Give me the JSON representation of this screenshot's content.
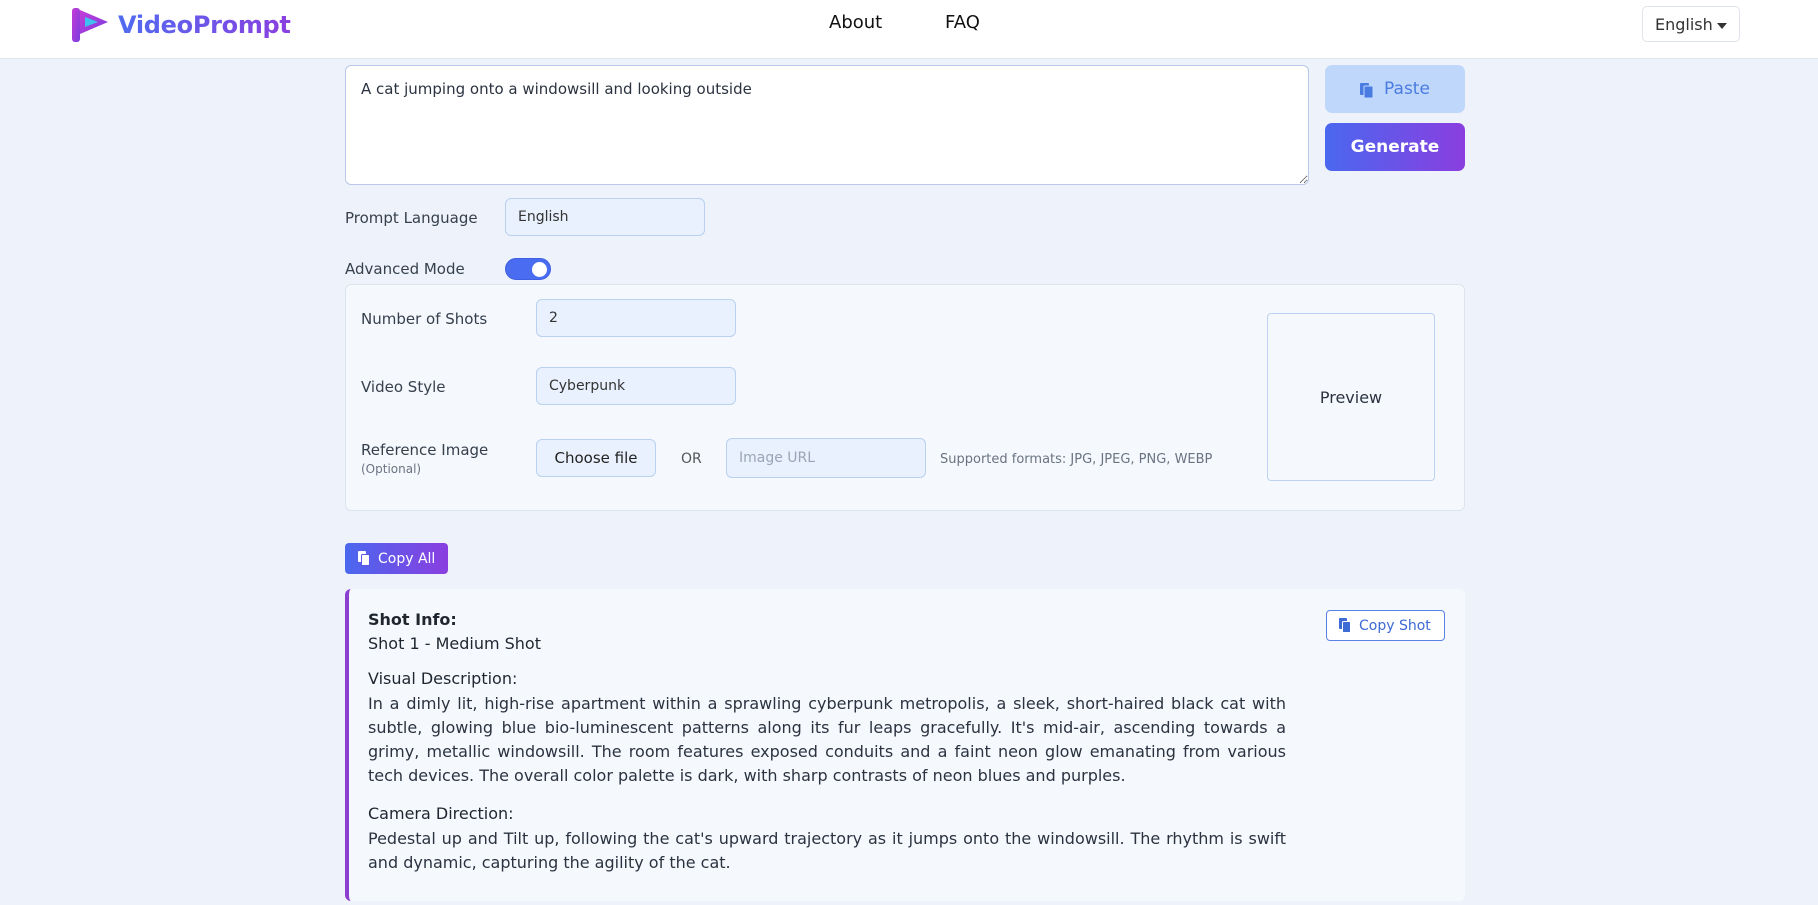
{
  "header": {
    "logo_text": "VideoPrompt",
    "nav": [
      {
        "label": "About"
      },
      {
        "label": "FAQ"
      }
    ],
    "language": "English"
  },
  "prompt": {
    "value": "A cat jumping onto a windowsill and looking outside",
    "paste_label": "Paste",
    "generate_label": "Generate"
  },
  "prompt_language": {
    "label": "Prompt Language",
    "value": "English"
  },
  "advanced_mode": {
    "label": "Advanced Mode",
    "enabled": true
  },
  "advanced": {
    "shots_label": "Number of Shots",
    "shots_value": "2",
    "style_label": "Video Style",
    "style_value": "Cyberpunk",
    "ref_label": "Reference Image",
    "ref_optional": "(Optional)",
    "choose_file": "Choose file",
    "or_text": "OR",
    "url_placeholder": "Image URL",
    "formats_note": "Supported formats: JPG, JPEG, PNG, WEBP",
    "preview_label": "Preview"
  },
  "copy_all_label": "Copy All",
  "shot": {
    "info_title": "Shot Info:",
    "info_value": "Shot 1 - Medium Shot",
    "visual_title": "Visual Description:",
    "visual_text": "In a dimly lit, high-rise apartment within a sprawling cyberpunk metropolis, a sleek, short-haired black cat with subtle, glowing blue bio-luminescent patterns along its fur leaps gracefully. It's mid-air, ascending towards a grimy, metallic windowsill. The room features exposed conduits and a faint neon glow emanating from various tech devices. The overall color palette is dark, with sharp contrasts of neon blues and purples.",
    "camera_title": "Camera Direction:",
    "camera_text": "Pedestal up and Tilt up, following the cat's upward trajectory as it jumps onto the windowsill. The rhythm is swift and dynamic, capturing the agility of the cat.",
    "copy_shot_label": "Copy Shot"
  },
  "colors": {
    "accent_start": "#4a68ef",
    "accent_end": "#8a3ee0",
    "background": "#eef3fb"
  }
}
